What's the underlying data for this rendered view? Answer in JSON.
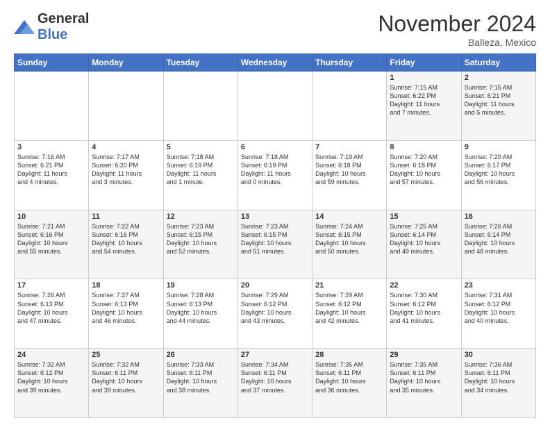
{
  "header": {
    "logo_line1": "General",
    "logo_line2": "Blue",
    "month_title": "November 2024",
    "location": "Balleza, Mexico"
  },
  "weekdays": [
    "Sunday",
    "Monday",
    "Tuesday",
    "Wednesday",
    "Thursday",
    "Friday",
    "Saturday"
  ],
  "weeks": [
    [
      {
        "day": "",
        "info": ""
      },
      {
        "day": "",
        "info": ""
      },
      {
        "day": "",
        "info": ""
      },
      {
        "day": "",
        "info": ""
      },
      {
        "day": "",
        "info": ""
      },
      {
        "day": "1",
        "info": "Sunrise: 7:15 AM\nSunset: 6:22 PM\nDaylight: 11 hours\nand 7 minutes."
      },
      {
        "day": "2",
        "info": "Sunrise: 7:15 AM\nSunset: 6:21 PM\nDaylight: 11 hours\nand 5 minutes."
      }
    ],
    [
      {
        "day": "3",
        "info": "Sunrise: 7:16 AM\nSunset: 6:21 PM\nDaylight: 11 hours\nand 4 minutes."
      },
      {
        "day": "4",
        "info": "Sunrise: 7:17 AM\nSunset: 6:20 PM\nDaylight: 11 hours\nand 3 minutes."
      },
      {
        "day": "5",
        "info": "Sunrise: 7:18 AM\nSunset: 6:19 PM\nDaylight: 11 hours\nand 1 minute."
      },
      {
        "day": "6",
        "info": "Sunrise: 7:18 AM\nSunset: 6:19 PM\nDaylight: 11 hours\nand 0 minutes."
      },
      {
        "day": "7",
        "info": "Sunrise: 7:19 AM\nSunset: 6:18 PM\nDaylight: 10 hours\nand 59 minutes."
      },
      {
        "day": "8",
        "info": "Sunrise: 7:20 AM\nSunset: 6:18 PM\nDaylight: 10 hours\nand 57 minutes."
      },
      {
        "day": "9",
        "info": "Sunrise: 7:20 AM\nSunset: 6:17 PM\nDaylight: 10 hours\nand 56 minutes."
      }
    ],
    [
      {
        "day": "10",
        "info": "Sunrise: 7:21 AM\nSunset: 6:16 PM\nDaylight: 10 hours\nand 55 minutes."
      },
      {
        "day": "11",
        "info": "Sunrise: 7:22 AM\nSunset: 6:16 PM\nDaylight: 10 hours\nand 54 minutes."
      },
      {
        "day": "12",
        "info": "Sunrise: 7:23 AM\nSunset: 6:15 PM\nDaylight: 10 hours\nand 52 minutes."
      },
      {
        "day": "13",
        "info": "Sunrise: 7:23 AM\nSunset: 6:15 PM\nDaylight: 10 hours\nand 51 minutes."
      },
      {
        "day": "14",
        "info": "Sunrise: 7:24 AM\nSunset: 6:15 PM\nDaylight: 10 hours\nand 50 minutes."
      },
      {
        "day": "15",
        "info": "Sunrise: 7:25 AM\nSunset: 6:14 PM\nDaylight: 10 hours\nand 49 minutes."
      },
      {
        "day": "16",
        "info": "Sunrise: 7:26 AM\nSunset: 6:14 PM\nDaylight: 10 hours\nand 48 minutes."
      }
    ],
    [
      {
        "day": "17",
        "info": "Sunrise: 7:26 AM\nSunset: 6:13 PM\nDaylight: 10 hours\nand 47 minutes."
      },
      {
        "day": "18",
        "info": "Sunrise: 7:27 AM\nSunset: 6:13 PM\nDaylight: 10 hours\nand 46 minutes."
      },
      {
        "day": "19",
        "info": "Sunrise: 7:28 AM\nSunset: 6:13 PM\nDaylight: 10 hours\nand 44 minutes."
      },
      {
        "day": "20",
        "info": "Sunrise: 7:29 AM\nSunset: 6:12 PM\nDaylight: 10 hours\nand 43 minutes."
      },
      {
        "day": "21",
        "info": "Sunrise: 7:29 AM\nSunset: 6:12 PM\nDaylight: 10 hours\nand 42 minutes."
      },
      {
        "day": "22",
        "info": "Sunrise: 7:30 AM\nSunset: 6:12 PM\nDaylight: 10 hours\nand 41 minutes."
      },
      {
        "day": "23",
        "info": "Sunrise: 7:31 AM\nSunset: 6:12 PM\nDaylight: 10 hours\nand 40 minutes."
      }
    ],
    [
      {
        "day": "24",
        "info": "Sunrise: 7:32 AM\nSunset: 6:12 PM\nDaylight: 10 hours\nand 39 minutes."
      },
      {
        "day": "25",
        "info": "Sunrise: 7:32 AM\nSunset: 6:11 PM\nDaylight: 10 hours\nand 39 minutes."
      },
      {
        "day": "26",
        "info": "Sunrise: 7:33 AM\nSunset: 6:11 PM\nDaylight: 10 hours\nand 38 minutes."
      },
      {
        "day": "27",
        "info": "Sunrise: 7:34 AM\nSunset: 6:11 PM\nDaylight: 10 hours\nand 37 minutes."
      },
      {
        "day": "28",
        "info": "Sunrise: 7:35 AM\nSunset: 6:11 PM\nDaylight: 10 hours\nand 36 minutes."
      },
      {
        "day": "29",
        "info": "Sunrise: 7:35 AM\nSunset: 6:11 PM\nDaylight: 10 hours\nand 35 minutes."
      },
      {
        "day": "30",
        "info": "Sunrise: 7:36 AM\nSunset: 6:11 PM\nDaylight: 10 hours\nand 34 minutes."
      }
    ]
  ]
}
